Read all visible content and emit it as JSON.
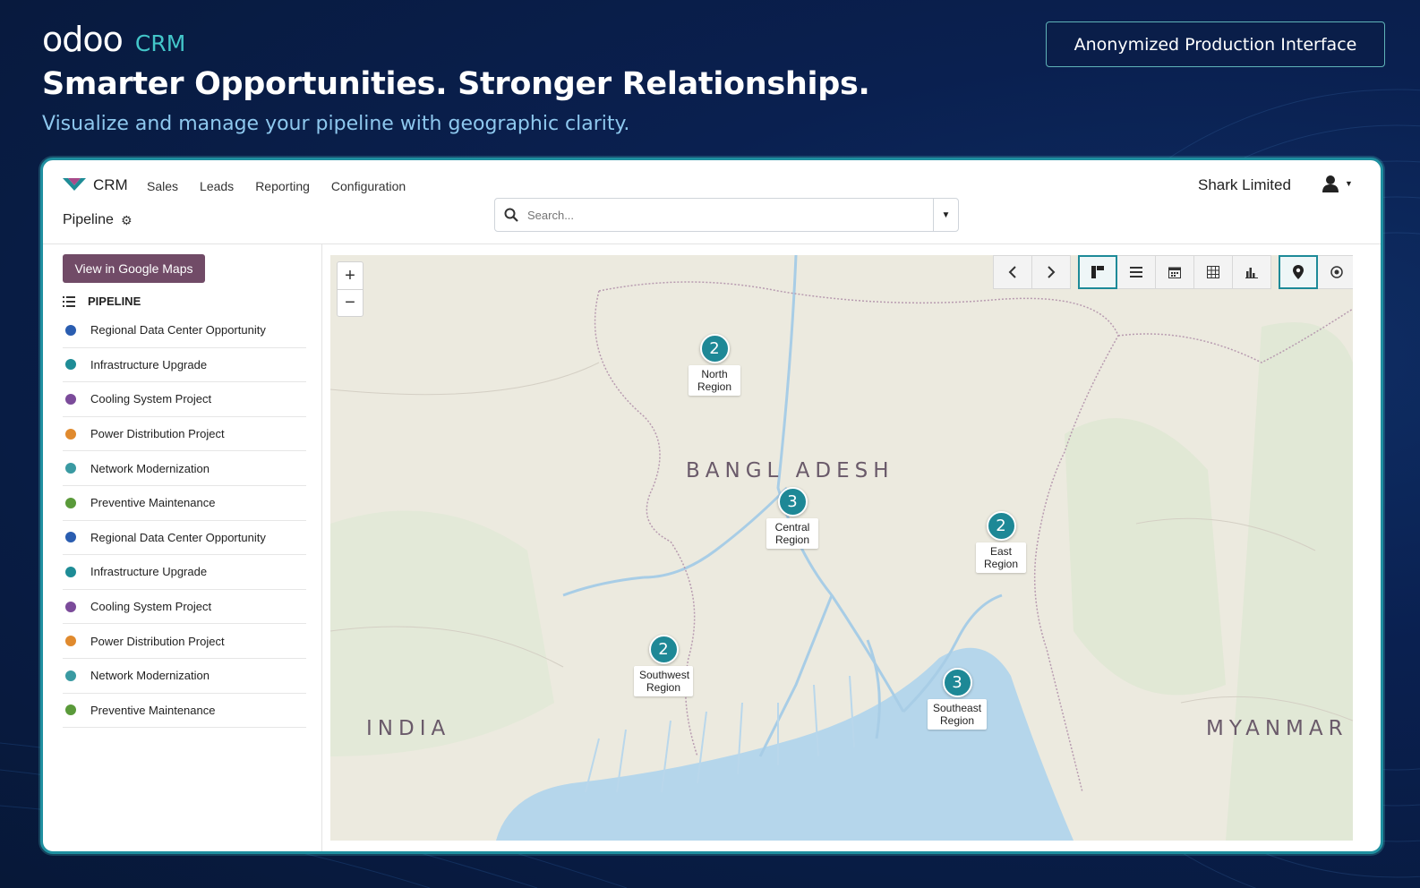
{
  "banner": {
    "logo_text": "odoo",
    "product": "CRM",
    "headline": "Smarter Opportunities. Stronger Relationships.",
    "subheadline": "Visualize and manage your pipeline with geographic clarity.",
    "badge": "Anonymized Production Interface"
  },
  "app": {
    "name": "CRM",
    "menu": [
      "Sales",
      "Leads",
      "Reporting",
      "Configuration"
    ],
    "breadcrumb": "Pipeline",
    "search_placeholder": "Search...",
    "company": "Shark Limited"
  },
  "sidebar": {
    "maps_button": "View in Google Maps",
    "pipeline_header": "PIPELINE",
    "items": [
      {
        "label": "Regional Data Center Opportunity",
        "color": "#2a5db0"
      },
      {
        "label": "Infrastructure Upgrade",
        "color": "#1e8c96"
      },
      {
        "label": "Cooling System Project",
        "color": "#7b4b9a"
      },
      {
        "label": "Power Distribution Project",
        "color": "#e08a2e"
      },
      {
        "label": "Network Modernization",
        "color": "#3a9aa2"
      },
      {
        "label": "Preventive Maintenance",
        "color": "#5a9a3a"
      },
      {
        "label": "Regional Data Center Opportunity",
        "color": "#2a5db0"
      },
      {
        "label": "Infrastructure Upgrade",
        "color": "#1e8c96"
      },
      {
        "label": "Cooling System Project",
        "color": "#7b4b9a"
      },
      {
        "label": "Power Distribution Project",
        "color": "#e08a2e"
      },
      {
        "label": "Network Modernization",
        "color": "#3a9aa2"
      },
      {
        "label": "Preventive Maintenance",
        "color": "#5a9a3a"
      }
    ]
  },
  "map": {
    "countries": {
      "bangladesh": "BANGL ADESH",
      "india": "INDIA",
      "myanmar": "MYANMAR"
    },
    "markers": [
      {
        "count": "2",
        "label": "North Region"
      },
      {
        "count": "3",
        "label": "Central Region"
      },
      {
        "count": "2",
        "label": "East Region"
      },
      {
        "count": "2",
        "label": "Southwest Region"
      },
      {
        "count": "3",
        "label": "Southeast Region"
      }
    ],
    "zoom_in": "+",
    "zoom_out": "−",
    "views": [
      "kanban-icon",
      "list-icon",
      "calendar-icon",
      "pivot-icon",
      "graph-icon",
      "map-pin-icon",
      "activity-icon"
    ],
    "active_view": "map-pin-icon"
  }
}
